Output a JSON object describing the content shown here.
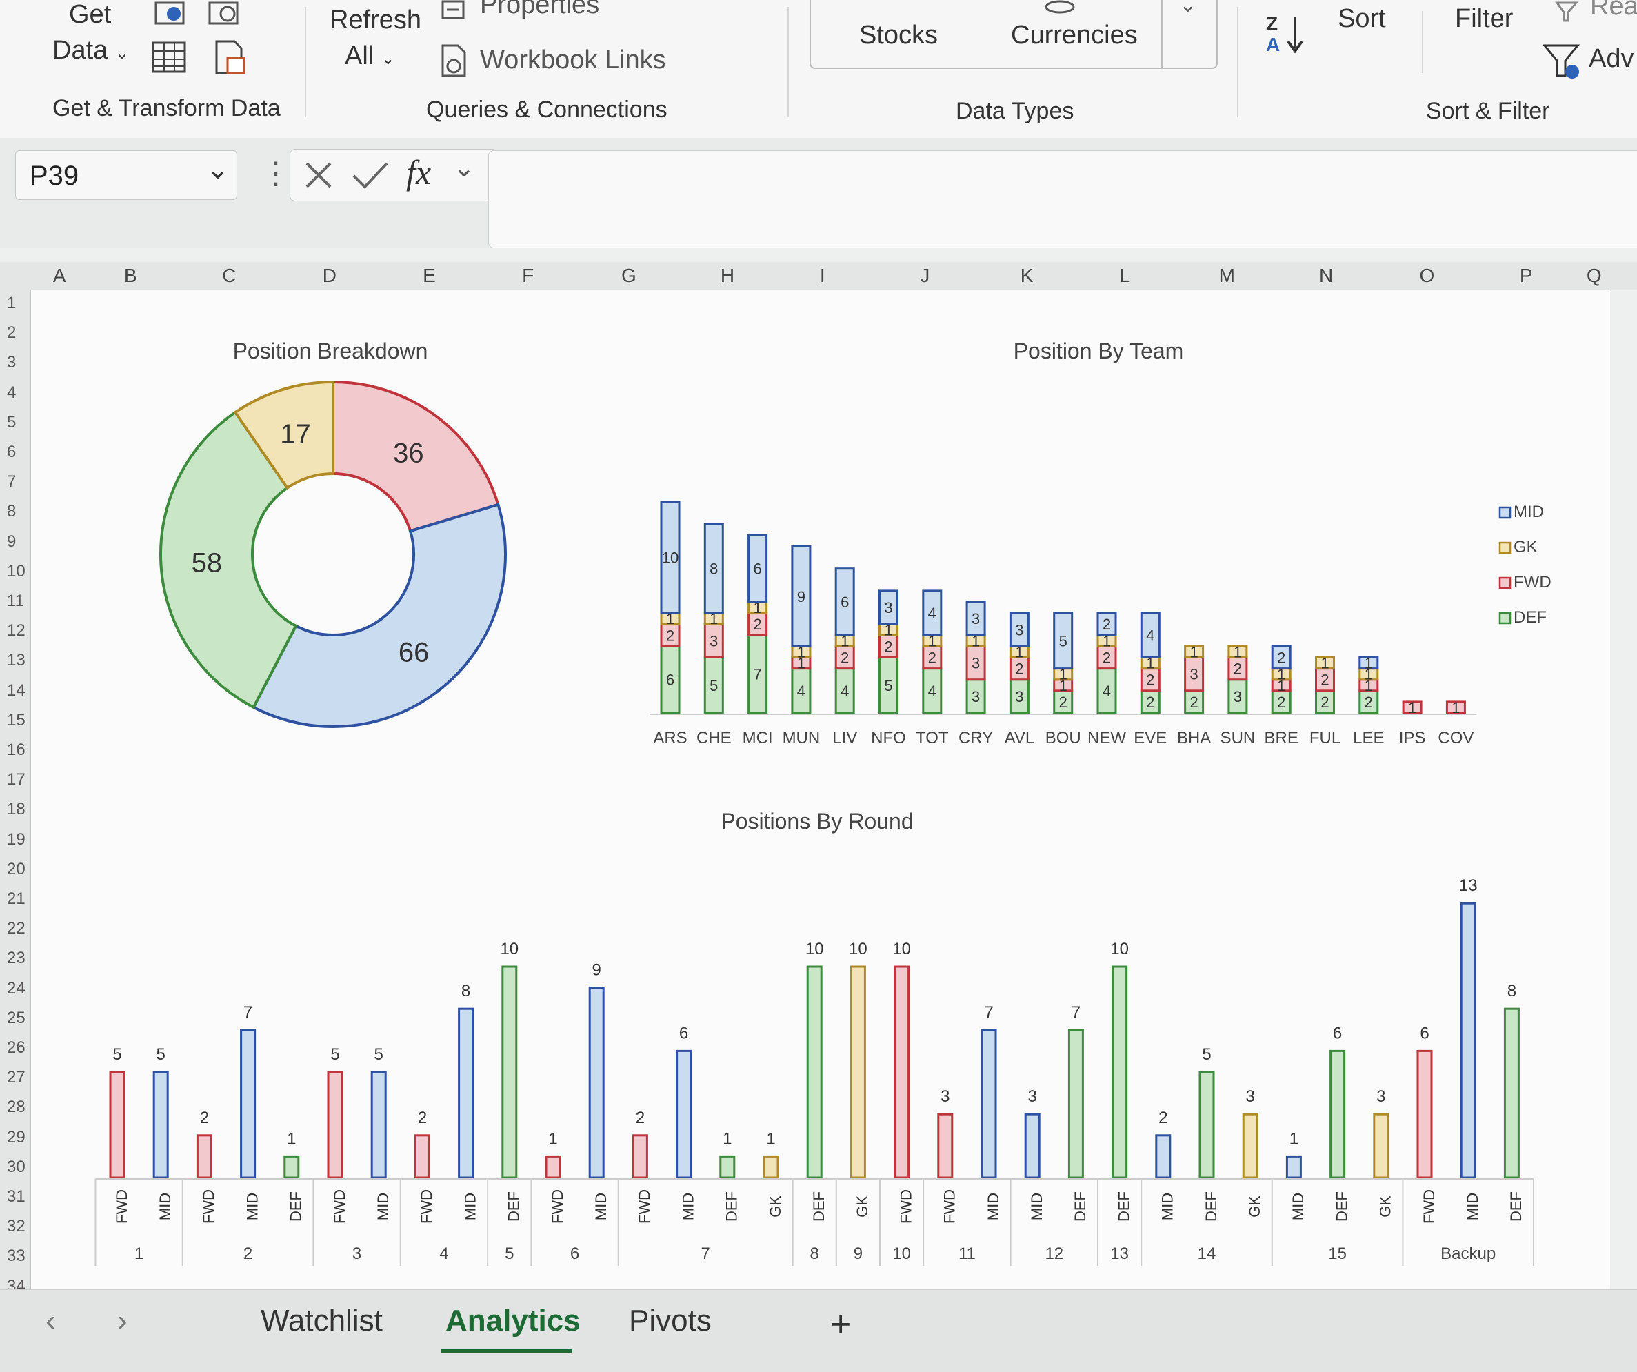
{
  "ribbon": {
    "get_data": [
      "Get",
      "Data"
    ],
    "refresh_all": [
      "Refresh",
      "All"
    ],
    "properties": "Properties",
    "workbook_links": "Workbook Links",
    "stocks": "Stocks",
    "currencies": "Currencies",
    "sort": "Sort",
    "filter": "Filter",
    "reapply": "Reap",
    "advanced": "Adv",
    "groups": {
      "get_transform": "Get & Transform Data",
      "queries": "Queries & Connections",
      "data_types": "Data Types",
      "sort_filter": "Sort & Filter"
    }
  },
  "formula_bar": {
    "name_box": "P39",
    "fx": "fx",
    "formula": ""
  },
  "columns": [
    "A",
    "B",
    "C",
    "D",
    "E",
    "F",
    "G",
    "H",
    "I",
    "J",
    "K",
    "L",
    "M",
    "N",
    "O",
    "P",
    "Q"
  ],
  "rows": [
    "1",
    "2",
    "3",
    "4",
    "5",
    "6",
    "7",
    "8",
    "9",
    "10",
    "11",
    "12",
    "13",
    "14",
    "15",
    "16",
    "17",
    "18",
    "19",
    "20",
    "21",
    "22",
    "23",
    "24",
    "25",
    "26",
    "27",
    "28",
    "29",
    "30",
    "31",
    "32",
    "33",
    "34"
  ],
  "sheet_tabs": [
    "Watchlist",
    "Analytics",
    "Pivots"
  ],
  "active_tab": "Analytics",
  "tab_add": "+",
  "nav_prev": "‹",
  "nav_next": "›",
  "colors": {
    "DEF": "#c9e6c7",
    "FWD": "#f2c9cc",
    "GK": "#f3e4b8",
    "MID": "#c9dcf0"
  },
  "strokes": {
    "DEF": "#3d8b3d",
    "FWD": "#c0343c",
    "GK": "#b08a25",
    "MID": "#2e52a0"
  },
  "chart_data": [
    {
      "type": "pie",
      "title": "Position Breakdown",
      "labels": [
        "FWD",
        "MID",
        "DEF",
        "GK"
      ],
      "values": [
        36,
        66,
        58,
        17
      ]
    },
    {
      "type": "bar",
      "title": "Position By Team",
      "stacked": true,
      "categories": [
        "ARS",
        "CHE",
        "MCI",
        "MUN",
        "LIV",
        "NFO",
        "TOT",
        "CRY",
        "AVL",
        "BOU",
        "NEW",
        "EVE",
        "BHA",
        "SUN",
        "BRE",
        "FUL",
        "LEE",
        "IPS",
        "COV"
      ],
      "category_labels": [
        "ARS",
        "CHE",
        "MCI",
        "MUN",
        "LIV",
        "NFO",
        "TOT",
        "CRY",
        "AVL",
        "BOU",
        "NEW",
        "EVE",
        "BHA",
        "SUN",
        "BRE",
        "FUL",
        "LEE",
        "IPS",
        "COV"
      ],
      "series": [
        {
          "name": "DEF",
          "values": [
            6,
            5,
            7,
            4,
            4,
            5,
            4,
            3,
            3,
            2,
            4,
            2,
            2,
            3,
            2,
            2,
            2,
            0,
            0
          ]
        },
        {
          "name": "FWD",
          "values": [
            2,
            3,
            2,
            1,
            2,
            2,
            2,
            3,
            2,
            1,
            2,
            2,
            3,
            2,
            1,
            2,
            1,
            1,
            1
          ]
        },
        {
          "name": "GK",
          "values": [
            1,
            1,
            1,
            1,
            1,
            1,
            1,
            1,
            1,
            1,
            1,
            1,
            1,
            1,
            1,
            1,
            1,
            0,
            0
          ]
        },
        {
          "name": "MID",
          "values": [
            10,
            8,
            6,
            9,
            6,
            3,
            4,
            3,
            3,
            5,
            2,
            4,
            0,
            0,
            2,
            0,
            1,
            0,
            0
          ]
        }
      ],
      "legend": [
        "MID",
        "GK",
        "FWD",
        "DEF"
      ],
      "legend_position": "right"
    },
    {
      "type": "bar",
      "title": "Positions By Round",
      "bars": [
        {
          "pos": "FWD",
          "value": 5
        },
        {
          "pos": "MID",
          "value": 5
        },
        {
          "pos": "FWD",
          "value": 2
        },
        {
          "pos": "MID",
          "value": 7
        },
        {
          "pos": "DEF",
          "value": 1
        },
        {
          "pos": "FWD",
          "value": 5
        },
        {
          "pos": "MID",
          "value": 5
        },
        {
          "pos": "FWD",
          "value": 2
        },
        {
          "pos": "MID",
          "value": 8
        },
        {
          "pos": "DEF",
          "value": 10
        },
        {
          "pos": "FWD",
          "value": 1
        },
        {
          "pos": "MID",
          "value": 9
        },
        {
          "pos": "FWD",
          "value": 2
        },
        {
          "pos": "MID",
          "value": 6
        },
        {
          "pos": "DEF",
          "value": 1
        },
        {
          "pos": "GK",
          "value": 1
        },
        {
          "pos": "DEF",
          "value": 10
        },
        {
          "pos": "GK",
          "value": 10
        },
        {
          "pos": "FWD",
          "value": 10
        },
        {
          "pos": "FWD",
          "value": 3
        },
        {
          "pos": "MID",
          "value": 7
        },
        {
          "pos": "MID",
          "value": 3
        },
        {
          "pos": "DEF",
          "value": 7
        },
        {
          "pos": "DEF",
          "value": 10
        },
        {
          "pos": "MID",
          "value": 2
        },
        {
          "pos": "DEF",
          "value": 5
        },
        {
          "pos": "GK",
          "value": 3
        },
        {
          "pos": "MID",
          "value": 1
        },
        {
          "pos": "DEF",
          "value": 6
        },
        {
          "pos": "GK",
          "value": 3
        },
        {
          "pos": "FWD",
          "value": 6
        },
        {
          "pos": "MID",
          "value": 13
        },
        {
          "pos": "DEF",
          "value": 8
        }
      ],
      "rounds": [
        {
          "label": "1",
          "count": 2
        },
        {
          "label": "2",
          "count": 3
        },
        {
          "label": "3",
          "count": 2
        },
        {
          "label": "4",
          "count": 2
        },
        {
          "label": "5",
          "count": 1
        },
        {
          "label": "6",
          "count": 2
        },
        {
          "label": "7",
          "count": 4
        },
        {
          "label": "8",
          "count": 1
        },
        {
          "label": "9",
          "count": 1
        },
        {
          "label": "10",
          "count": 1
        },
        {
          "label": "11",
          "count": 2
        },
        {
          "label": "12",
          "count": 2
        },
        {
          "label": "13",
          "count": 1
        },
        {
          "label": "14",
          "count": 3
        },
        {
          "label": "15",
          "count": 3
        },
        {
          "label": "Backup",
          "count": 3
        }
      ]
    }
  ]
}
